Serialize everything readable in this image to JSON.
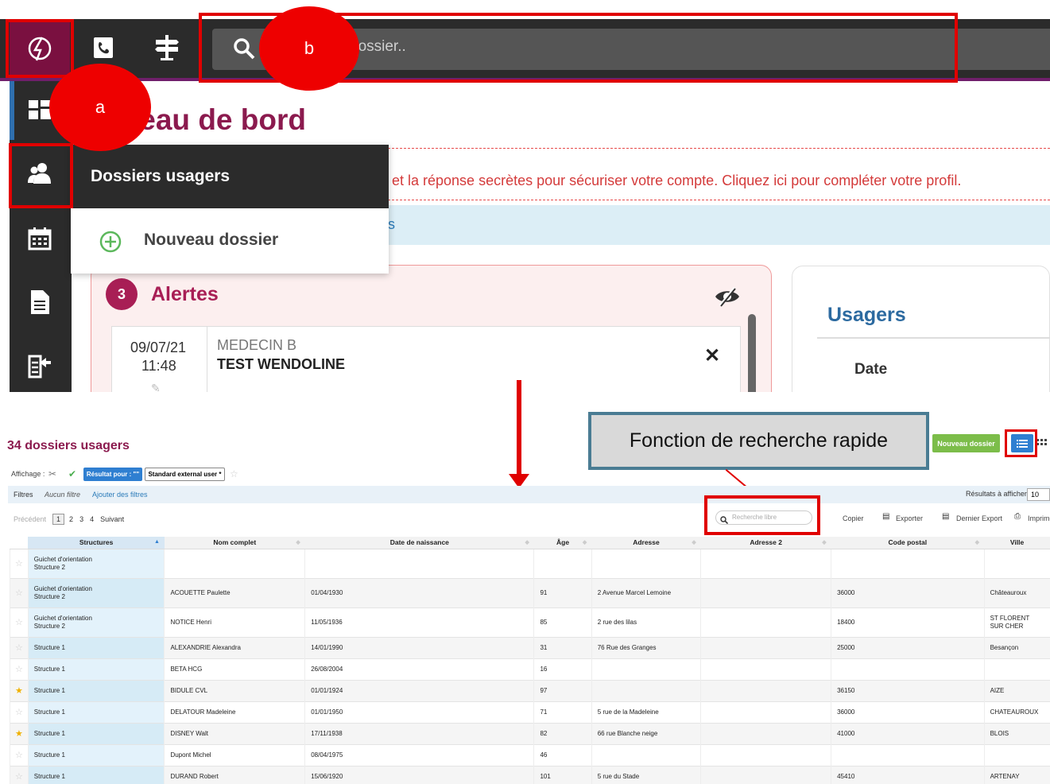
{
  "top": {
    "search_placeholder": "dossier..",
    "page_title_fragment": "leau de bord",
    "warning_text": "et la réponse secrètes pour sécuriser votre compte. Cliquez ici pour compléter votre profil.",
    "info_band_fragment": "s",
    "dropdown": {
      "header": "Dossiers usagers",
      "item": "Nouveau dossier"
    },
    "alerts": {
      "count": "3",
      "title": "Alertes",
      "item": {
        "date": "09/07/21",
        "time": "11:48",
        "author": "MEDECIN B",
        "name": "TEST WENDOLINE",
        "close": "✕"
      }
    },
    "usagers": {
      "title": "Usagers",
      "column": "Date"
    },
    "annotations": {
      "a": "a",
      "b": "b"
    }
  },
  "bottom": {
    "title": "34 dossiers usagers",
    "callout": "Fonction de recherche rapide",
    "new_button": "Nouveau dossier",
    "affichage_label": "Affichage :",
    "resultat_button": "Résultat pour : \"\"",
    "standard_button": "Standard external user *",
    "filters": {
      "label": "Filtres",
      "none": "Aucun filtre",
      "add": "Ajouter des filtres",
      "results_label": "Résultats à afficher",
      "results_value": "10"
    },
    "pager": {
      "prev": "Précédent",
      "pages": [
        "1",
        "2",
        "3",
        "4"
      ],
      "next": "Suivant"
    },
    "search_placeholder": "Recherche libre",
    "toolbar": {
      "copy": "Copier",
      "export": "Exporter",
      "last_export": "Dernier Export",
      "print": "Imprimer"
    },
    "columns": [
      "Structures",
      "Nom complet",
      "Date de naissance",
      "Âge",
      "Adresse",
      "Adresse 2",
      "Code postal",
      "Ville"
    ],
    "rows": [
      {
        "fav": false,
        "structure": [
          "Guichet d'orientation",
          "Structure 2"
        ],
        "name": "",
        "dob": "",
        "age": "",
        "address": "",
        "address2": "",
        "zip": "",
        "city": ""
      },
      {
        "fav": false,
        "structure": [
          "Guichet d'orientation",
          "Structure 2"
        ],
        "name": "ACOUETTE Paulette",
        "dob": "01/04/1930",
        "age": "91",
        "address": "2 Avenue Marcel Lemoine",
        "address2": "",
        "zip": "36000",
        "city": "Châteauroux"
      },
      {
        "fav": false,
        "structure": [
          "Guichet d'orientation",
          "Structure 2"
        ],
        "name": "NOTICE Henri",
        "dob": "11/05/1936",
        "age": "85",
        "address": "2 rue des lilas",
        "address2": "",
        "zip": "18400",
        "city": "ST FLORENT\nSUR CHER"
      },
      {
        "fav": false,
        "structure": [
          "Structure 1"
        ],
        "name": "ALEXANDRIE Alexandra",
        "dob": "14/01/1990",
        "age": "31",
        "address": "76 Rue des Granges",
        "address2": "",
        "zip": "25000",
        "city": "Besançon"
      },
      {
        "fav": false,
        "structure": [
          "Structure 1"
        ],
        "name": "BETA HCG",
        "dob": "26/08/2004",
        "age": "16",
        "address": "",
        "address2": "",
        "zip": "",
        "city": ""
      },
      {
        "fav": true,
        "structure": [
          "Structure 1"
        ],
        "name": "BIDULE CVL",
        "dob": "01/01/1924",
        "age": "97",
        "address": "",
        "address2": "",
        "zip": "36150",
        "city": "AIZE"
      },
      {
        "fav": false,
        "structure": [
          "Structure 1"
        ],
        "name": "DELATOUR Madeleine",
        "dob": "01/01/1950",
        "age": "71",
        "address": "5 rue de la Madeleine",
        "address2": "",
        "zip": "36000",
        "city": "CHATEAUROUX"
      },
      {
        "fav": true,
        "structure": [
          "Structure 1"
        ],
        "name": "DISNEY Walt",
        "dob": "17/11/1938",
        "age": "82",
        "address": "66 rue Blanche neige",
        "address2": "",
        "zip": "41000",
        "city": "BLOIS"
      },
      {
        "fav": false,
        "structure": [
          "Structure 1"
        ],
        "name": "Dupont Michel",
        "dob": "08/04/1975",
        "age": "46",
        "address": "",
        "address2": "",
        "zip": "",
        "city": ""
      },
      {
        "fav": false,
        "structure": [
          "Structure 1"
        ],
        "name": "DURAND Robert",
        "dob": "15/06/1920",
        "age": "101",
        "address": "5 rue du Stade",
        "address2": "",
        "zip": "45410",
        "city": "ARTENAY"
      }
    ]
  },
  "colors": {
    "brand": "#8b1a4e",
    "annotation_red": "#e00000",
    "primary_blue": "#2f7fd1",
    "success_green": "#7cbd4a"
  }
}
